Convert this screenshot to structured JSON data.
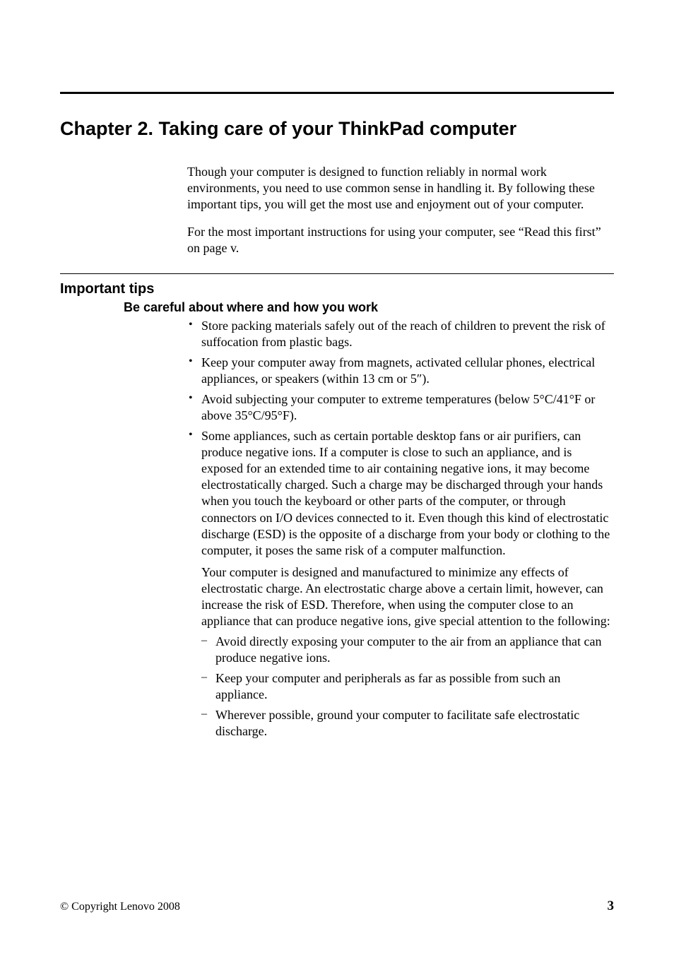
{
  "chapter": {
    "title": "Chapter 2. Taking care of your ThinkPad computer"
  },
  "intro": {
    "p1": "Though your computer is designed to function reliably in normal work environments, you need to use common sense in handling it. By following these important tips, you will get the most use and enjoyment out of your computer.",
    "p2": "For the most important instructions for using your computer, see “Read this first” on page v."
  },
  "section": {
    "heading": "Important tips",
    "subheading": "Be careful about where and how you work"
  },
  "bullets": {
    "b1": "Store packing materials safely out of the reach of children to prevent the risk of suffocation from plastic bags.",
    "b2": "Keep your computer away from magnets, activated cellular phones, electrical appliances, or speakers (within 13 cm or 5″).",
    "b3": "Avoid subjecting your computer to extreme temperatures (below 5°C/41°F or above 35°C/95°F).",
    "b4": "Some appliances, such as certain portable desktop fans or air purifiers, can produce negative ions. If a computer is close to such an appliance, and is exposed for an extended time to air containing negative ions, it may become electrostatically charged. Such a charge may be discharged through your hands when you touch the keyboard or other parts of the computer, or through connectors on I/O devices connected to it. Even though this kind of electrostatic discharge (ESD) is the opposite of a discharge from your body or clothing to the computer, it poses the same risk of a computer malfunction.",
    "b4_sub": "Your computer is designed and manufactured to minimize any effects of electrostatic charge. An electrostatic charge above a certain limit, however, can increase the risk of ESD. Therefore, when using the computer close to an appliance that can produce negative ions, give special attention to the following:",
    "b4_i1": "Avoid directly exposing your computer to the air from an appliance that can produce negative ions.",
    "b4_i2": "Keep your computer and peripherals as far as possible from such an appliance.",
    "b4_i3": "Wherever possible, ground your computer to facilitate safe electrostatic discharge."
  },
  "footer": {
    "copyright": "© Copyright Lenovo 2008",
    "page_number": "3"
  }
}
